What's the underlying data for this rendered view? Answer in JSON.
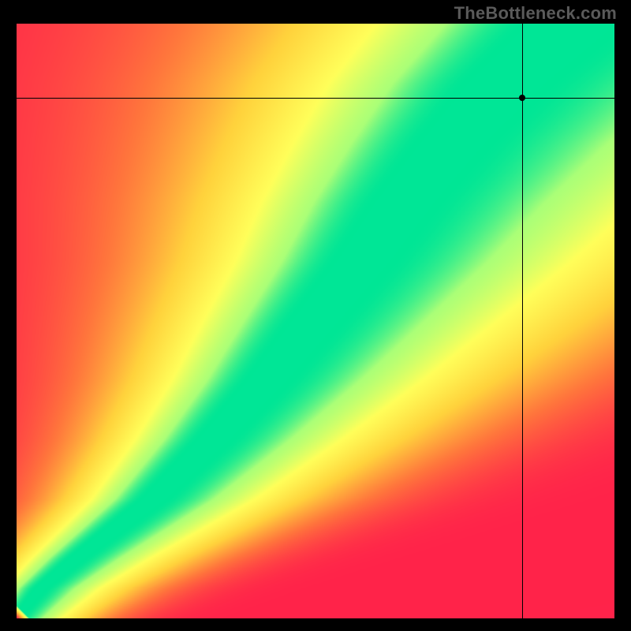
{
  "watermark": "TheBottleneck.com",
  "chart_data": {
    "type": "heatmap",
    "title": "",
    "xlabel": "",
    "ylabel": "",
    "xlim": [
      0,
      1
    ],
    "ylim": [
      0,
      1
    ],
    "color_stops": [
      {
        "t": 0.0,
        "r": 255,
        "g": 35,
        "b": 74
      },
      {
        "t": 0.28,
        "r": 255,
        "g": 120,
        "b": 60
      },
      {
        "t": 0.55,
        "r": 255,
        "g": 210,
        "b": 60
      },
      {
        "t": 0.78,
        "r": 255,
        "g": 255,
        "b": 90
      },
      {
        "t": 0.93,
        "r": 170,
        "g": 255,
        "b": 120
      },
      {
        "t": 1.0,
        "r": 0,
        "g": 230,
        "b": 150
      }
    ],
    "ridge_curve": {
      "description": "Approximate x position of the green optimal ridge as a function of y (normalized 0..1 from plot-bottom).",
      "points": [
        {
          "y": 0.0,
          "x": 0.0
        },
        {
          "y": 0.05,
          "x": 0.04
        },
        {
          "y": 0.1,
          "x": 0.1
        },
        {
          "y": 0.2,
          "x": 0.23
        },
        {
          "y": 0.3,
          "x": 0.33
        },
        {
          "y": 0.4,
          "x": 0.42
        },
        {
          "y": 0.5,
          "x": 0.5
        },
        {
          "y": 0.6,
          "x": 0.58
        },
        {
          "y": 0.7,
          "x": 0.65
        },
        {
          "y": 0.8,
          "x": 0.73
        },
        {
          "y": 0.9,
          "x": 0.82
        },
        {
          "y": 1.0,
          "x": 0.93
        }
      ]
    },
    "ridge_half_width_y": {
      "description": "Approximate vertical half-thickness of the bright green band (in y-units) at a few y stations.",
      "points": [
        {
          "y": 0.0,
          "w": 0.005
        },
        {
          "y": 0.2,
          "w": 0.02
        },
        {
          "y": 0.5,
          "w": 0.04
        },
        {
          "y": 0.8,
          "w": 0.055
        },
        {
          "y": 1.0,
          "w": 0.075
        }
      ]
    },
    "marker": {
      "x": 0.845,
      "y": 0.875,
      "description": "Black crosshair dot marking a specific (x,y) location on the heatmap."
    }
  }
}
